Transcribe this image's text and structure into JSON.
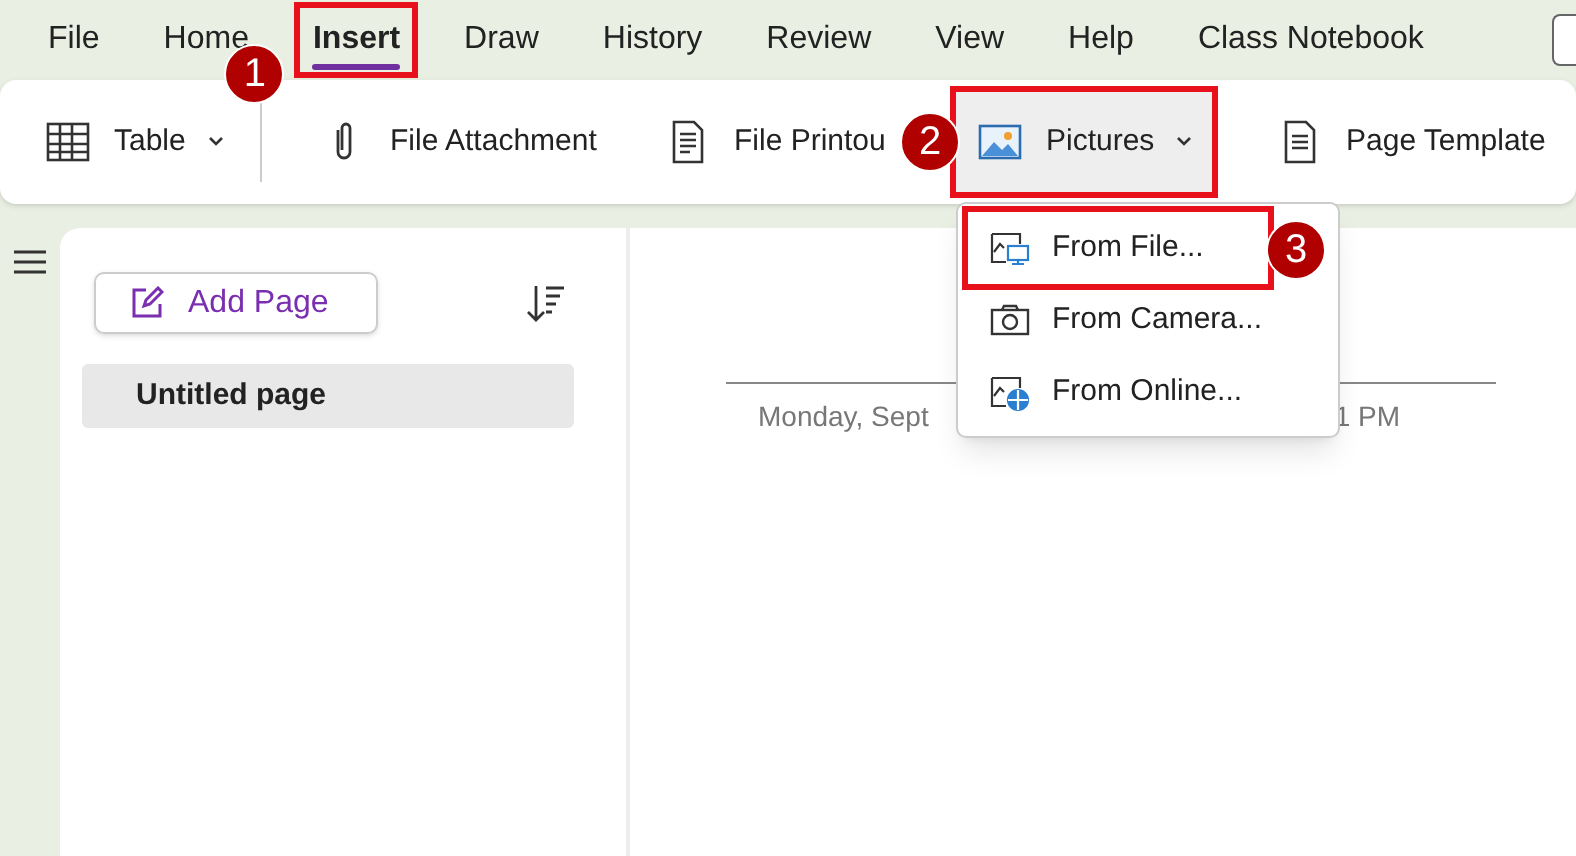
{
  "menu_bar": [
    {
      "label": "File",
      "selected": false
    },
    {
      "label": "Home",
      "selected": false
    },
    {
      "label": "Insert",
      "selected": true,
      "callout": "1"
    },
    {
      "label": "Draw",
      "selected": false
    },
    {
      "label": "History",
      "selected": false
    },
    {
      "label": "Review",
      "selected": false
    },
    {
      "label": "View",
      "selected": false
    },
    {
      "label": "Help",
      "selected": false
    },
    {
      "label": "Class Notebook",
      "selected": false
    }
  ],
  "ribbon": [
    {
      "kind": "table",
      "label": "Table",
      "dropdown": true
    },
    {
      "kind": "attachment",
      "label": "File Attachment",
      "dropdown": false
    },
    {
      "kind": "printout",
      "label": "File Printou",
      "dropdown": false
    },
    {
      "kind": "pictures",
      "label": "Pictures",
      "dropdown": true,
      "callout": "2"
    },
    {
      "kind": "templates",
      "label": "Page Template",
      "dropdown": false
    }
  ],
  "pictures_menu": [
    {
      "kind": "file",
      "label": "From File...",
      "callout": "3"
    },
    {
      "kind": "camera",
      "label": "From Camera..."
    },
    {
      "kind": "online",
      "label": "From Online..."
    }
  ],
  "pages_panel": {
    "add_button": "Add Page",
    "pages": [
      {
        "title": "Untitled page",
        "selected": true
      }
    ]
  },
  "page": {
    "date_parts": [
      "Monday, Sept",
      "1 PM"
    ]
  }
}
